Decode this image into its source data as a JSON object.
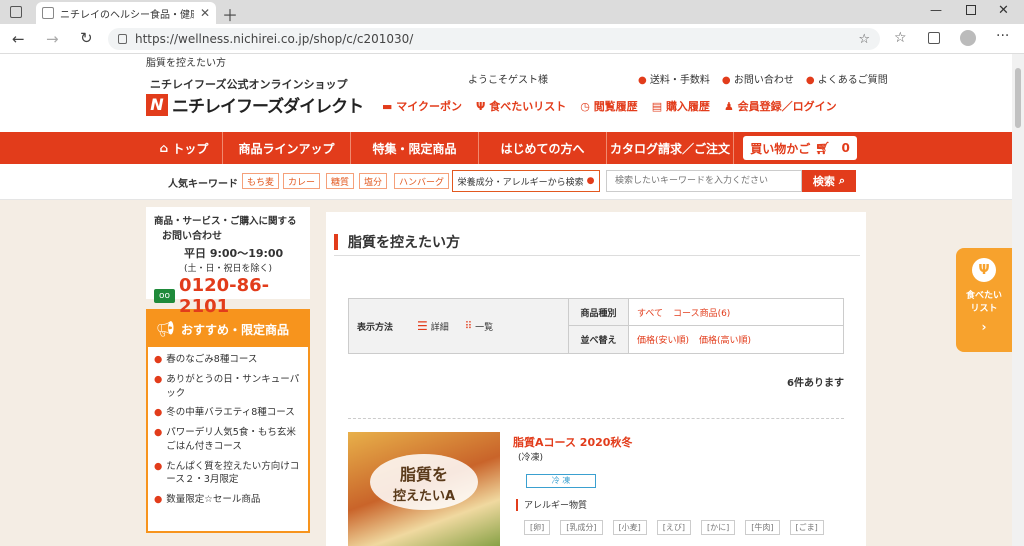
{
  "browser": {
    "tab_title": "ニチレイのヘルシー食品・健康管理食",
    "url": "https://wellness.nichirei.co.jp/shop/c/c201030/"
  },
  "page": {
    "breadcrumb": "脂質を控えたい方",
    "header": {
      "subtitle": "ニチレイフーズ公式オンラインショップ",
      "logo_text": "ニチレイフーズダイレクト",
      "welcome": "ようこそゲスト様",
      "top_links": [
        "送料・手数料",
        "お問い合わせ",
        "よくあるご質問"
      ],
      "nav_links": [
        "マイクーポン",
        "食べたいリスト",
        "閲覧履歴",
        "購入履歴",
        "会員登録／ログイン"
      ]
    },
    "menu": [
      "トップ",
      "商品ラインアップ",
      "特集・限定商品",
      "はじめての方へ",
      "カタログ請求／ご注文"
    ],
    "cart": {
      "label": "買い物かご",
      "count": "0"
    },
    "keywords": {
      "label": "人気キーワード",
      "items": [
        "もち麦",
        "カレー",
        "糖質",
        "塩分",
        "ハンバーグ"
      ],
      "allergy_search": "栄養成分・アレルギーから検索",
      "search_placeholder": "検索したいキーワードを入力ください",
      "search_button": "検索"
    },
    "contact": {
      "line1": "商品・サービス・ご購入に関する",
      "line2": "お問い合わせ",
      "hours": "平日 9:00〜19:00",
      "holiday": "(土・日・祝日を除く)",
      "phone": "0120-86-2101"
    },
    "recommend": {
      "title": "おすすめ・限定商品",
      "items": [
        "春のなごみ8種コース",
        "ありがとうの日・サンキューパック",
        "冬の中華バラエティ8種コース",
        "パワーデリ人気5食・もち玄米ごはん付きコース",
        "たんぱく質を控えたい方向けコース２・3月限定",
        "数量限定☆セール商品"
      ]
    },
    "main": {
      "heading": "脂質を控えたい方",
      "display_label": "表示方法",
      "display_detail": "詳細",
      "display_list": "一覧",
      "type_label": "商品種別",
      "type_all": "すべて",
      "type_course": "コース商品(6)",
      "sort_label": "並べ替え",
      "sort_low": "価格(安い順)",
      "sort_high": "価格(高い順)",
      "count": "6件あります",
      "product": {
        "name": "脂質Aコース 2020秋冬",
        "storage": "(冷凍)",
        "badge": "冷 凍",
        "allergy_label": "アレルギー物質",
        "allergens": [
          "[卵]",
          "[乳成分]",
          "[小麦]",
          "[えび]",
          "[かに]",
          "[牛肉]",
          "[ごま]"
        ],
        "image_text_1": "脂質を",
        "image_text_2": "控えたいA"
      }
    },
    "float_tab": {
      "line1": "食べたい",
      "line2": "リスト"
    }
  }
}
